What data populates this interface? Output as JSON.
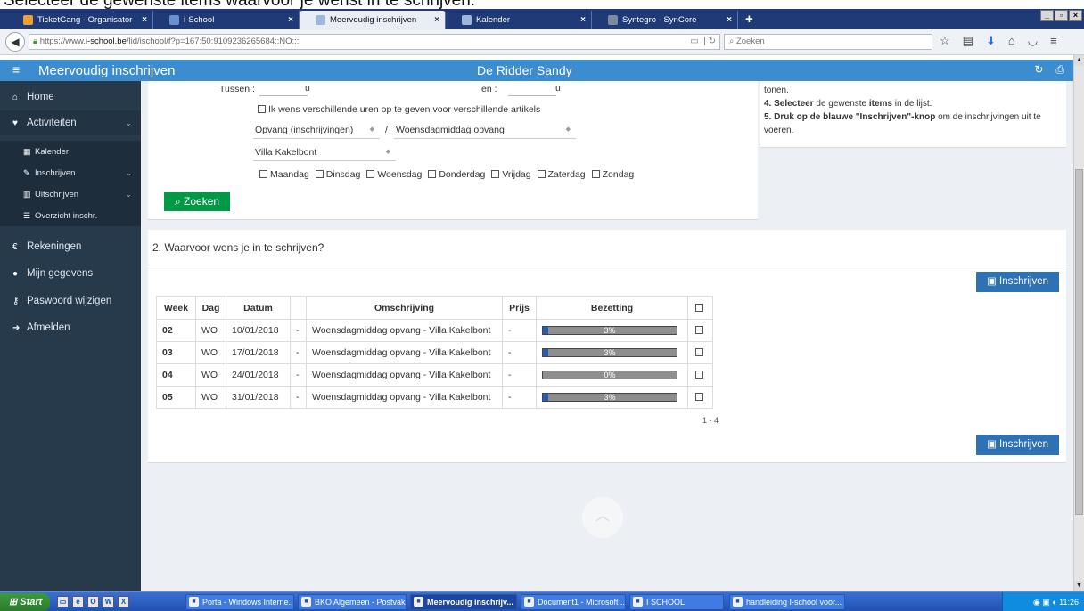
{
  "caption": "Selecteer de gewenste items waarvoor je wenst in te schrijven.",
  "browser": {
    "tabs": [
      {
        "label": "TicketGang - Organisator",
        "color": "#f0a030",
        "active": false
      },
      {
        "label": "i-School",
        "color": "#6a8fd0",
        "active": false
      },
      {
        "label": "Meervoudig inschrijven",
        "color": "#9fb7d8",
        "active": true
      },
      {
        "label": "Kalender",
        "color": "#9fb7d8",
        "active": false
      },
      {
        "label": "Syntegro - SynCore",
        "color": "#7a8aa0",
        "active": false
      }
    ],
    "close_glyph": "×",
    "new_tab": "+",
    "window_buttons": [
      "_",
      "▫",
      "×"
    ],
    "url_prefix": "https://www.",
    "url_domain": "i-school.be",
    "url_rest": "/lid/ischool/f?p=167:50:9109236265684::NO:::",
    "search_placeholder": "Zoeken"
  },
  "app": {
    "title": "Meervoudig inschrijven",
    "user": "De Ridder Sandy"
  },
  "sidebar": {
    "items": [
      {
        "label": "Home",
        "icon": "home-icon",
        "glyph": "⌂"
      },
      {
        "label": "Activiteiten",
        "icon": "heartbeat-icon",
        "glyph": "♥"
      },
      {
        "label": "Kalender",
        "icon": "calendar-icon",
        "glyph": "▦"
      },
      {
        "label": "Inschrijven",
        "icon": "edit-icon",
        "glyph": "✎"
      },
      {
        "label": "Uitschrijven",
        "icon": "trash-icon",
        "glyph": "▥"
      },
      {
        "label": "Overzicht inschr.",
        "icon": "list-icon",
        "glyph": "☰"
      },
      {
        "label": "Rekeningen",
        "icon": "euro-icon",
        "glyph": "€"
      },
      {
        "label": "Mijn gegevens",
        "icon": "user-icon",
        "glyph": "●"
      },
      {
        "label": "Paswoord wijzigen",
        "icon": "key-icon",
        "glyph": "⚷"
      },
      {
        "label": "Afmelden",
        "icon": "sign-out-icon",
        "glyph": "➜"
      }
    ]
  },
  "filter": {
    "tussen_label": "Tussen :",
    "en_label": "en :",
    "unit": "u",
    "checkbox_label": "Ik wens verschillende uren op te geven voor verschillende artikels",
    "select1": "Opvang (inschrijvingen)",
    "separator": "/",
    "select2": "Woensdagmiddag opvang",
    "select3": "Villa Kakelbont",
    "days": [
      "Maandag",
      "Dinsdag",
      "Woensdag",
      "Donderdag",
      "Vrijdag",
      "Zaterdag",
      "Zondag"
    ],
    "search_button": "Zoeken"
  },
  "help": {
    "line0": "tonen.",
    "line1_num": "4. ",
    "line1_b1": "Selecteer",
    "line1_mid": " de gewenste ",
    "line1_b2": "items",
    "line1_end": " in de lijst.",
    "line2_num": "5. ",
    "line2_b": "Druk op de blauwe \"Inschrijven\"-knop",
    "line2_end": " om de inschrijvingen uit te",
    "line3": "voeren."
  },
  "section2": {
    "title": "2. Waarvoor wens je in te schrijven?",
    "button": "Inschrijven",
    "columns": [
      "Week",
      "Dag",
      "Datum",
      "",
      "Omschrijving",
      "Prijs",
      "Bezetting"
    ],
    "rows": [
      {
        "week": "02",
        "dag": "WO",
        "datum": "10/01/2018",
        "sep": "-",
        "omschrijving": "Woensdagmiddag opvang - Villa Kakelbont",
        "prijs": "-",
        "bezetting": "3%",
        "fill": 0.03
      },
      {
        "week": "03",
        "dag": "WO",
        "datum": "17/01/2018",
        "sep": "-",
        "omschrijving": "Woensdagmiddag opvang - Villa Kakelbont",
        "prijs": "-",
        "bezetting": "3%",
        "fill": 0.03
      },
      {
        "week": "04",
        "dag": "WO",
        "datum": "24/01/2018",
        "sep": "-",
        "omschrijving": "Woensdagmiddag opvang - Villa Kakelbont",
        "prijs": "-",
        "bezetting": "0%",
        "fill": 0.0
      },
      {
        "week": "05",
        "dag": "WO",
        "datum": "31/01/2018",
        "sep": "-",
        "omschrijving": "Woensdagmiddag opvang - Villa Kakelbont",
        "prijs": "-",
        "bezetting": "3%",
        "fill": 0.03
      }
    ],
    "pager": "1 - 4"
  },
  "taskbar": {
    "start": "Start",
    "buttons": [
      {
        "label": "Porta - Windows Interne...",
        "icon": "ie-icon",
        "active": false
      },
      {
        "label": "BKO Algemeen - Postvak...",
        "icon": "outlook-icon",
        "active": false
      },
      {
        "label": "Meervoudig inschrijv...",
        "icon": "firefox-icon",
        "active": true
      },
      {
        "label": "Document1 - Microsoft ...",
        "icon": "word-icon",
        "active": false
      },
      {
        "label": "I SCHOOL",
        "icon": "folder-icon",
        "active": false
      },
      {
        "label": "handleiding I-school voor...",
        "icon": "pdf-icon",
        "active": false
      }
    ],
    "time": "11:26"
  }
}
